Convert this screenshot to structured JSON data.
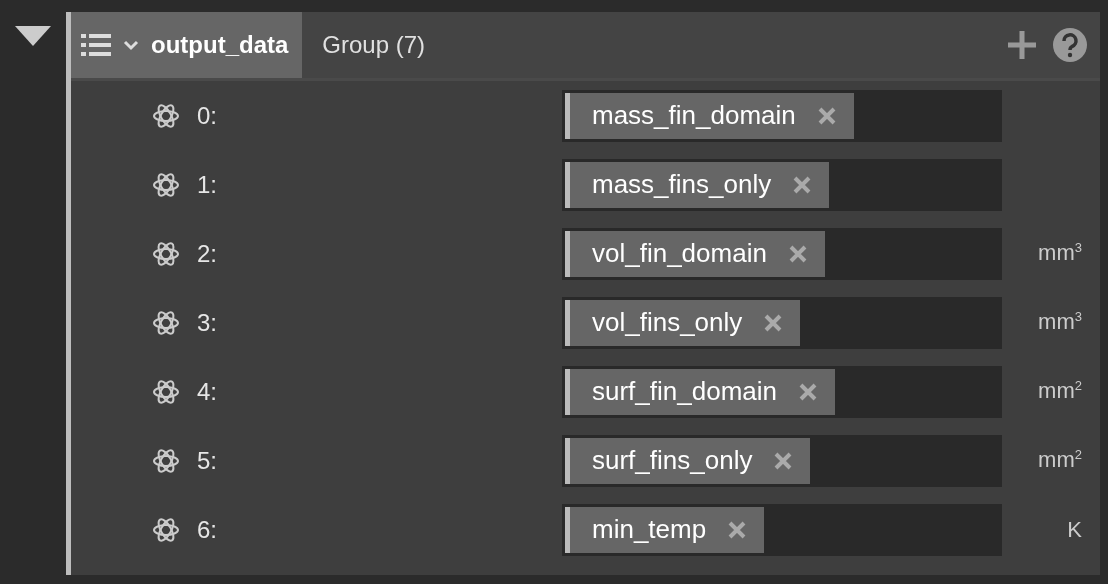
{
  "group": {
    "expanded": true,
    "name": "output_data",
    "type_label": "Group (7)",
    "name_tab_selected": true
  },
  "items": [
    {
      "index": "0:",
      "value": "mass_fin_domain"
    },
    {
      "index": "1:",
      "value": "mass_fins_only"
    },
    {
      "index": "2:",
      "value": "vol_fin_domain",
      "unit": "mm$^{3}$"
    },
    {
      "index": "3:",
      "value": "vol_fins_only",
      "unit": "mm$^{3}$"
    },
    {
      "index": "4:",
      "value": "surf_fin_domain",
      "unit": "mm$^{2}$"
    },
    {
      "index": "5:",
      "value": "surf_fins_only",
      "unit": "mm$^{2}$"
    },
    {
      "index": "6:",
      "value": "min_temp",
      "unit": "K"
    }
  ]
}
